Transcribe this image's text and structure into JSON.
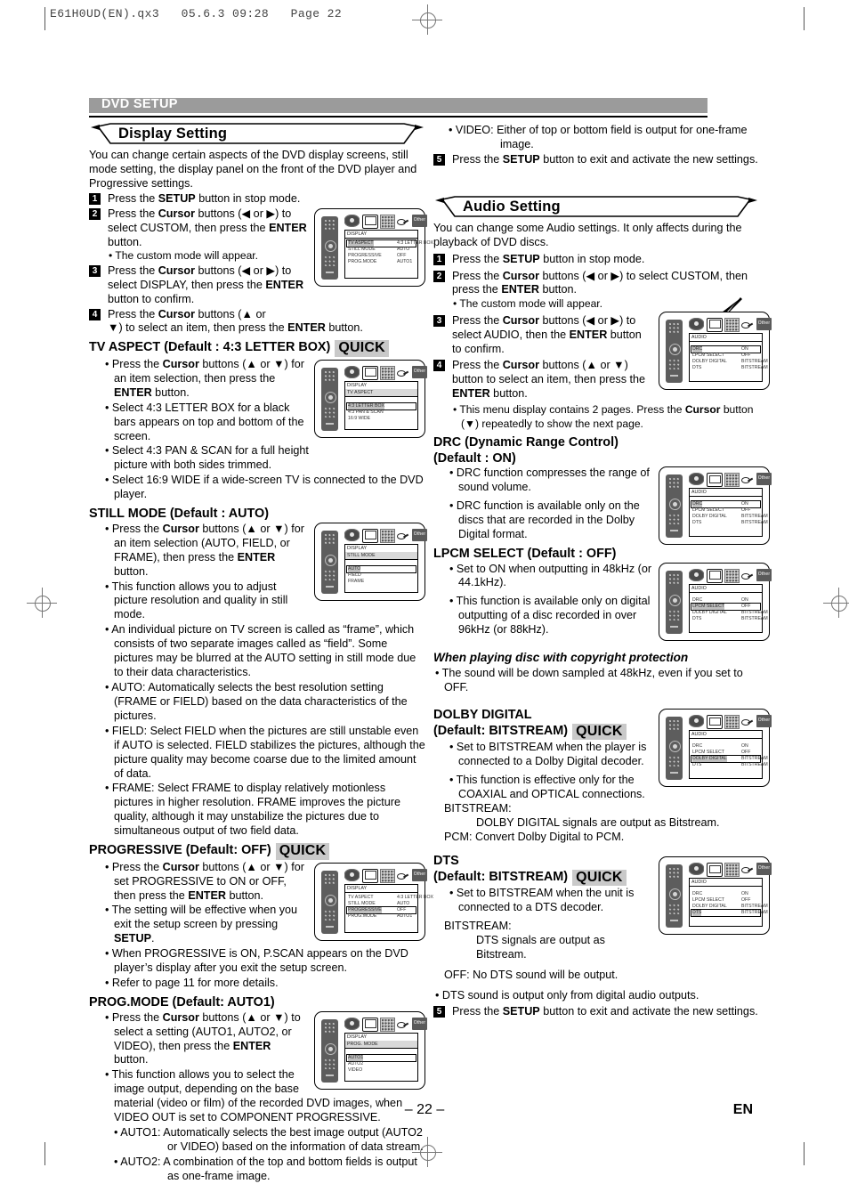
{
  "file_header": "E61H0UD(EN).qx3   05.6.3 09:28   Page 22",
  "section_bar": {
    "label": "DVD SETUP"
  },
  "footer": {
    "page_number": "– 22 –",
    "language": "EN"
  },
  "left_column": {
    "banner_title": "Display Setting",
    "intro": "You can change certain aspects of the DVD display screens, still mode setting, the display panel on the front of the DVD player and Progressive settings.",
    "steps": [
      {
        "num": "1",
        "text": "Press the SETUP button in stop mode."
      },
      {
        "num": "2",
        "text": "Press the Cursor buttons (◀ or ▶) to select CUSTOM, then press the ENTER button."
      },
      {
        "num": "3",
        "text": "Press the Cursor buttons (◀ or ▶) to select DISPLAY, then press the ENTER button to confirm."
      },
      {
        "num": "4",
        "text": "Press the Cursor buttons (▲ or ▼) to select an item, then press the ENTER button."
      }
    ],
    "step2_note": "• The custom mode will appear.",
    "settings": [
      {
        "title": "TV ASPECT (Default : 4:3 LETTER BOX)",
        "quick": "QUICK",
        "bullets": [
          "• Press the Cursor buttons (▲ or ▼) for an item selection, then press the ENTER button.",
          "• Select 4:3 LETTER BOX for a black bars appears on top and bottom of the screen.",
          "• Select 4:3 PAN & SCAN for a full height picture with both sides trimmed.",
          "• Select 16:9 WIDE if a wide-screen TV is connected to the DVD player."
        ]
      },
      {
        "title": "STILL MODE (Default : AUTO)",
        "quick": "",
        "bullets": [
          "• Press the Cursor buttons (▲ or ▼) for an item selection (AUTO, FIELD, or FRAME), then press the ENTER button.",
          "• This function allows you to adjust picture resolution and quality in still mode.",
          "• An individual picture on TV screen is called as “frame”, which consists of two separate images called as “field”. Some pictures may be blurred at the AUTO setting in still mode due to their data characteristics.",
          "• AUTO: Automatically selects the best resolution setting (FRAME or FIELD) based on the data characteristics of the pictures.",
          "• FIELD: Select FIELD when the pictures are still unstable even if AUTO is selected.  FIELD stabilizes the pictures, although the picture quality may become coarse due to the limited amount of data.",
          "• FRAME: Select FRAME to display relatively motionless pictures in higher resolution. FRAME improves the picture quality, although it may unstabilize the pictures due to simultaneous output of two field data."
        ]
      },
      {
        "title": "PROGRESSIVE (Default: OFF)",
        "quick": "QUICK",
        "bullets": [
          "• Press the Cursor buttons (▲ or ▼) for set PROGRESSIVE to ON or OFF, then press the ENTER button.",
          "• The setting will be effective when you exit the setup screen by pressing SETUP.",
          "• When PROGRESSIVE is ON, P.SCAN appears on the DVD player’s display after you exit the setup screen.",
          "• Refer to page 11 for more details."
        ]
      },
      {
        "title": "PROG.MODE (Default: AUTO1)",
        "quick": "",
        "bullets": [
          "• Press the Cursor buttons (▲ or ▼) to select a setting (AUTO1, AUTO2, or VIDEO), then press the ENTER button.",
          "• This function allows you to select the image output, depending on the base material (video or film) of the recorded DVD images, when VIDEO OUT is set to COMPONENT PROGRESSIVE.",
          "• AUTO1: Automatically selects the best image output (AUTO2 or VIDEO) based on the information of data stream.",
          "• AUTO2: A combination of the top and bottom fields is output as one-frame image."
        ]
      }
    ]
  },
  "right_column": {
    "carryover_bullet": "• VIDEO: Either of top or bottom field is output for one-frame image.",
    "carryover_step": {
      "num": "5",
      "text": "Press the SETUP button to exit and activate the new settings."
    },
    "banner_title": "Audio Setting",
    "intro": "You can change some Audio settings. It only affects during the playback of DVD discs.",
    "steps": [
      {
        "num": "1",
        "text": "Press the SETUP button in stop mode."
      },
      {
        "num": "2",
        "text": "Press the Cursor buttons (◀ or ▶) to select CUSTOM, then press the ENTER button."
      },
      {
        "num": "3",
        "text": "Press the Cursor buttons (◀ or ▶) to select AUDIO, then the ENTER button to confirm."
      },
      {
        "num": "4",
        "text": "Press the Cursor buttons (▲ or ▼) button to select an item, then press the ENTER button."
      }
    ],
    "step2_note": "• The custom mode will appear.",
    "step4_note": "• This menu display contains 2 pages. Press the Cursor button (▼) repeatedly to show the next page.",
    "settings": [
      {
        "title": "DRC (Dynamic Range Control)",
        "title2": "(Default : ON)",
        "quick": "",
        "bullets": [
          "• DRC function compresses the range of sound volume.",
          "• DRC function is available only on the discs that are recorded in the Dolby Digital format."
        ]
      },
      {
        "title": "LPCM SELECT (Default : OFF)",
        "title2": "",
        "quick": "",
        "bullets": [
          "• Set to ON when outputting in 48kHz (or 44.1kHz).",
          "• This function is available only on digital outputting of a disc recorded in over 96kHz (or 88kHz)."
        ]
      }
    ],
    "copyright_heading": "When playing disc with copyright protection",
    "copyright_bullet": "• The sound will be down sampled at 48kHz, even if you set to OFF.",
    "dolby": {
      "title": "DOLBY DIGITAL",
      "title2": "(Default: BITSTREAM)",
      "quick": "QUICK",
      "bullets": [
        "• Set to BITSTREAM when the player is connected to a Dolby Digital decoder.",
        "• This function is effective only for the COAXIAL and OPTICAL connections."
      ],
      "bitstream_label": "BITSTREAM:",
      "bitstream_text": "DOLBY DIGITAL signals are output as Bitstream.",
      "pcm_text": "PCM: Convert Dolby Digital to PCM."
    },
    "dts": {
      "title": "DTS",
      "title2": "(Default: BITSTREAM)",
      "quick": "QUICK",
      "bullets": [
        "• Set to BITSTREAM when the unit is connected to a DTS decoder."
      ],
      "bitstream_label": "BITSTREAM:",
      "bitstream_text": "DTS signals are output as Bitstream.",
      "off_text": "OFF: No DTS sound will be output.",
      "last_bullet": "• DTS sound is output only from digital audio outputs."
    },
    "final_step": {
      "num": "5",
      "text": "Press the SETUP button to exit and activate the new settings."
    }
  },
  "illustrations": {
    "display_main": {
      "menu_title": "DISPLAY",
      "rows": [
        {
          "label": "TV ASPECT",
          "value": "4:3 LETTER BOX",
          "selected": true
        },
        {
          "label": "STILL MODE",
          "value": "AUTO",
          "selected": false
        },
        {
          "label": "PROGRESSIVE",
          "value": "OFF",
          "selected": false
        },
        {
          "label": "PROG.MODE",
          "value": "AUTO1",
          "selected": false
        }
      ]
    },
    "tv_aspect": {
      "menu_title": "DISPLAY",
      "menu_sub": "TV ASPECT",
      "rows": [
        {
          "label": "4:3 LETTER BOX",
          "value": "",
          "selected": true
        },
        {
          "label": "4:3 PAN & SCAN",
          "value": "",
          "selected": false
        },
        {
          "label": "16:9 WIDE",
          "value": "",
          "selected": false
        }
      ]
    },
    "still_mode": {
      "menu_title": "DISPLAY",
      "menu_sub": "STILL MODE",
      "rows": [
        {
          "label": "AUTO",
          "value": "",
          "selected": true
        },
        {
          "label": "FIELD",
          "value": "",
          "selected": false
        },
        {
          "label": "FRAME",
          "value": "",
          "selected": false
        }
      ]
    },
    "progressive": {
      "menu_title": "DISPLAY",
      "rows": [
        {
          "label": "TV ASPECT",
          "value": "4:3 LETTER BOX",
          "selected": false
        },
        {
          "label": "STILL MODE",
          "value": "AUTO",
          "selected": false
        },
        {
          "label": "PROGRESSIVE",
          "value": "OFF",
          "selected": true
        },
        {
          "label": "PROG.MODE",
          "value": "AUTO1",
          "selected": false
        }
      ]
    },
    "prog_mode": {
      "menu_title": "DISPLAY",
      "menu_sub": "PROG. MODE",
      "rows": [
        {
          "label": "AUTO1",
          "value": "",
          "selected": true
        },
        {
          "label": "AUTO2",
          "value": "",
          "selected": false
        },
        {
          "label": "VIDEO",
          "value": "",
          "selected": false
        }
      ]
    },
    "audio_main": {
      "menu_title": "AUDIO",
      "rows": [
        {
          "label": "DRC",
          "value": "ON",
          "selected": true
        },
        {
          "label": "LPCM SELECT",
          "value": "OFF",
          "selected": false
        },
        {
          "label": "DOLBY DIGITAL",
          "value": "BITSTREAM",
          "selected": false
        },
        {
          "label": "DTS",
          "value": "BITSTREAM",
          "selected": false
        }
      ]
    },
    "audio_drc": {
      "menu_title": "AUDIO",
      "rows": [
        {
          "label": "DRC",
          "value": "ON",
          "selected": true
        },
        {
          "label": "LPCM SELECT",
          "value": "OFF",
          "selected": false
        },
        {
          "label": "DOLBY DIGITAL",
          "value": "BITSTREAM",
          "selected": false
        },
        {
          "label": "DTS",
          "value": "BITSTREAM",
          "selected": false
        }
      ]
    },
    "audio_lpcm": {
      "menu_title": "AUDIO",
      "rows": [
        {
          "label": "DRC",
          "value": "ON",
          "selected": false
        },
        {
          "label": "LPCM SELECT",
          "value": "OFF",
          "selected": true
        },
        {
          "label": "DOLBY DIGITAL",
          "value": "BITSTREAM",
          "selected": false
        },
        {
          "label": "DTS",
          "value": "BITSTREAM",
          "selected": false
        }
      ]
    },
    "audio_dolby": {
      "menu_title": "AUDIO",
      "rows": [
        {
          "label": "DRC",
          "value": "ON",
          "selected": false
        },
        {
          "label": "LPCM SELECT",
          "value": "OFF",
          "selected": false
        },
        {
          "label": "DOLBY DIGITAL",
          "value": "BITSTREAM",
          "selected": true
        },
        {
          "label": "DTS",
          "value": "BITSTREAM",
          "selected": false
        }
      ]
    },
    "audio_dts": {
      "menu_title": "AUDIO",
      "rows": [
        {
          "label": "DRC",
          "value": "ON",
          "selected": false
        },
        {
          "label": "LPCM SELECT",
          "value": "OFF",
          "selected": false
        },
        {
          "label": "DOLBY DIGITAL",
          "value": "BITSTREAM",
          "selected": false
        },
        {
          "label": "DTS",
          "value": "BITSTREAM",
          "selected": true
        }
      ]
    },
    "icon_labels": [
      "disc-icon",
      "tv-icon",
      "speaker-icon",
      "key-icon",
      "other-icon"
    ],
    "other_icon_text": "Other"
  }
}
